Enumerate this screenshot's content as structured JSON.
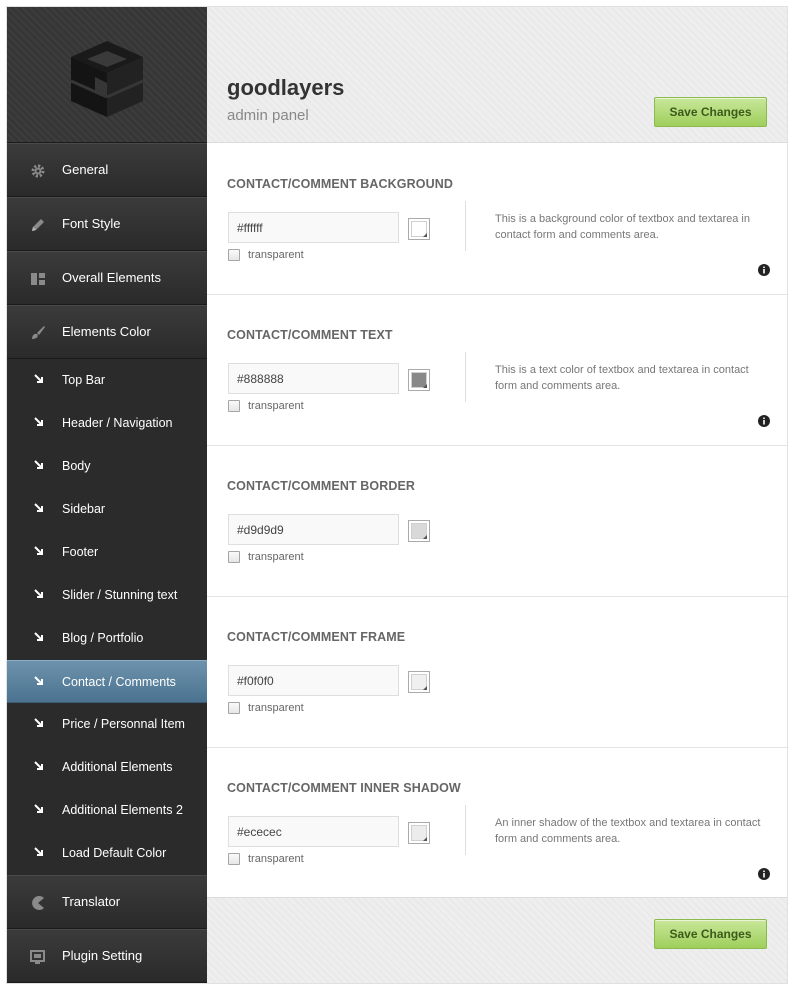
{
  "brand": {
    "name": "goodlayers",
    "subtitle": "admin panel"
  },
  "buttons": {
    "save_top": "Save Changes",
    "save_bottom": "Save Changes"
  },
  "sidebar": {
    "main_items": [
      {
        "label": "General",
        "icon": "gear-icon"
      },
      {
        "label": "Font Style",
        "icon": "pencil-icon"
      },
      {
        "label": "Overall Elements",
        "icon": "layout-icon"
      },
      {
        "label": "Elements Color",
        "icon": "brush-icon"
      },
      {
        "label": "Translator",
        "icon": "pacman-icon"
      },
      {
        "label": "Plugin Setting",
        "icon": "plugin-icon"
      }
    ],
    "sub_items": [
      {
        "label": "Top Bar"
      },
      {
        "label": "Header / Navigation"
      },
      {
        "label": "Body"
      },
      {
        "label": "Sidebar"
      },
      {
        "label": "Footer"
      },
      {
        "label": "Slider / Stunning text"
      },
      {
        "label": "Blog / Portfolio"
      },
      {
        "label": "Contact / Comments"
      },
      {
        "label": "Price / Personnal Item"
      },
      {
        "label": "Additional Elements"
      },
      {
        "label": "Additional Elements 2"
      },
      {
        "label": "Load Default Color"
      }
    ],
    "active_sub": "Contact / Comments"
  },
  "sections": [
    {
      "title": "CONTACT/COMMENT BACKGROUND",
      "value": "#ffffff",
      "swatch_color": "#ffffff",
      "transparent_label": "transparent",
      "transparent_checked": false,
      "description": "This is a background color of textbox and textarea in contact form and comments area."
    },
    {
      "title": "CONTACT/COMMENT TEXT",
      "value": "#888888",
      "swatch_color": "#888888",
      "transparent_label": "transparent",
      "transparent_checked": false,
      "description": "This is a text color of textbox and textarea in contact form and comments area."
    },
    {
      "title": "CONTACT/COMMENT BORDER",
      "value": "#d9d9d9",
      "swatch_color": "#d9d9d9",
      "transparent_label": "transparent",
      "transparent_checked": false,
      "description": ""
    },
    {
      "title": "CONTACT/COMMENT FRAME",
      "value": "#f0f0f0",
      "swatch_color": "#f0f0f0",
      "transparent_label": "transparent",
      "transparent_checked": false,
      "description": ""
    },
    {
      "title": "CONTACT/COMMENT INNER SHADOW",
      "value": "#ececec",
      "swatch_color": "#ececec",
      "transparent_label": "transparent",
      "transparent_checked": false,
      "description": "An inner shadow of the textbox and textarea in contact form and comments area."
    }
  ],
  "colors": {
    "save_button": "#a9d56c",
    "active_item": "#5d84a0",
    "sidebar_bg": "#2b2b2b"
  }
}
